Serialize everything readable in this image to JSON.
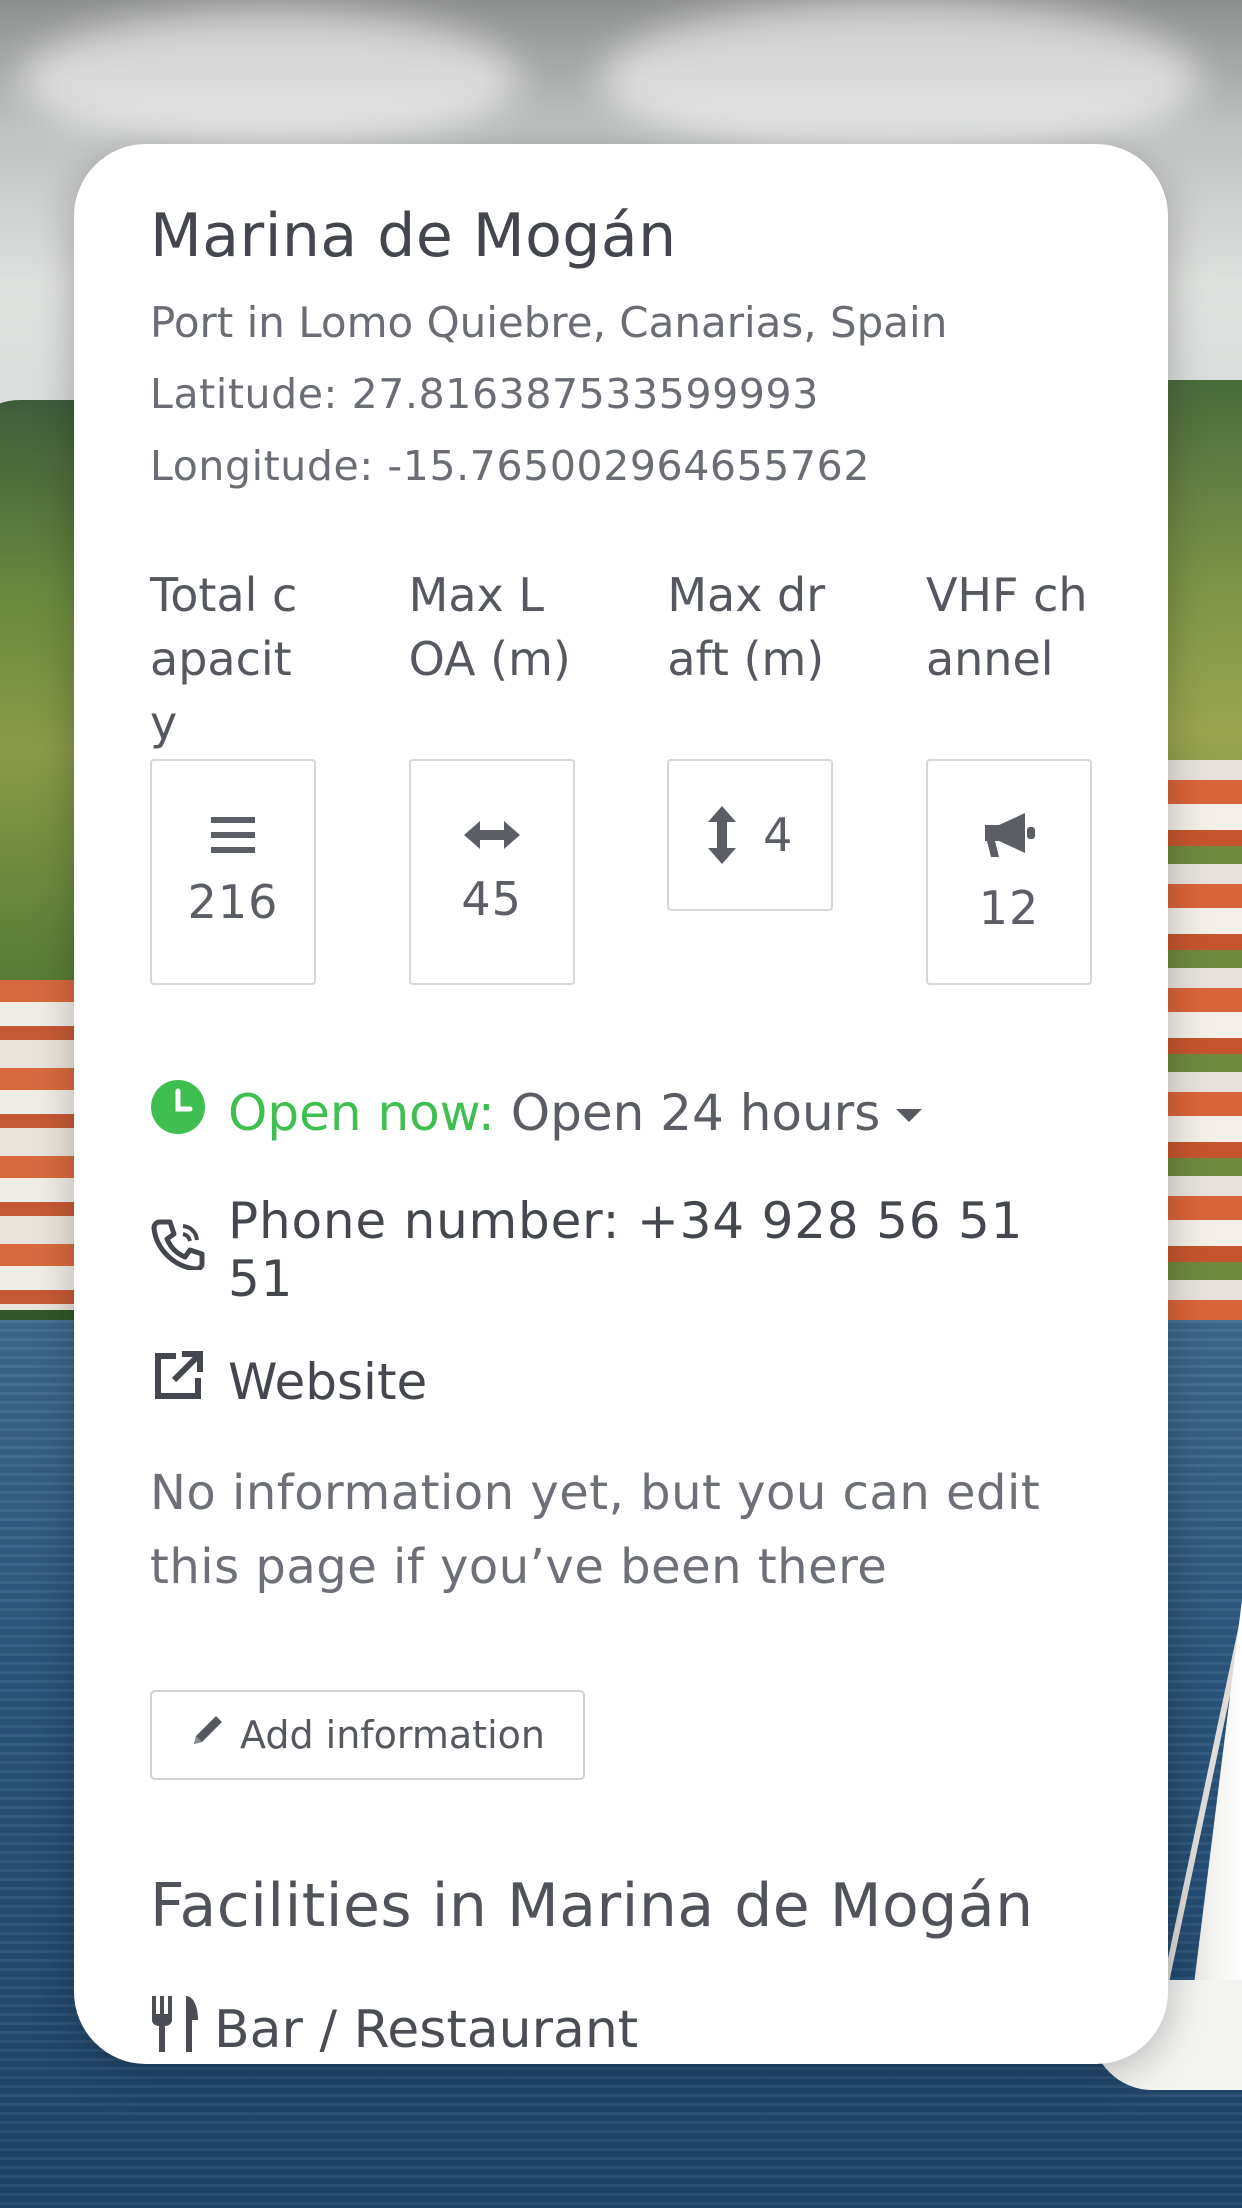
{
  "marina": {
    "title": "Marina de Mogán",
    "subtitle": "Port in Lomo Quiebre, Canarias, Spain",
    "latitude": "Latitude: 27.816387533599993",
    "longitude": "Longitude: -15.765002964655762"
  },
  "stats": [
    {
      "label": "Total capacity",
      "value": "216",
      "icon": "list-icon"
    },
    {
      "label": "Max LOA (m)",
      "value": "45",
      "icon": "horizontal-arrows-icon"
    },
    {
      "label": "Max draft (m)",
      "value": "4",
      "icon": "vertical-arrows-icon"
    },
    {
      "label": "VHF channel",
      "value": "12",
      "icon": "megaphone-icon"
    }
  ],
  "hours": {
    "label": "Open now:",
    "value": "Open 24 hours",
    "icon": "clock-icon",
    "label_color": "#3fbf4f"
  },
  "phone": {
    "text": "Phone number: +34 928 56 51 51",
    "icon": "phone-icon"
  },
  "website": {
    "text": "Website",
    "icon": "external-link-icon"
  },
  "noinfo": "No information yet, but you can edit this page if you’ve been there",
  "add_button": {
    "label": "Add information",
    "icon": "pencil-icon"
  },
  "facilities": {
    "title": "Facilities in Marina de Mogán",
    "items": [
      {
        "label": "Bar / Restaurant",
        "icon": "utensils-icon"
      }
    ]
  }
}
